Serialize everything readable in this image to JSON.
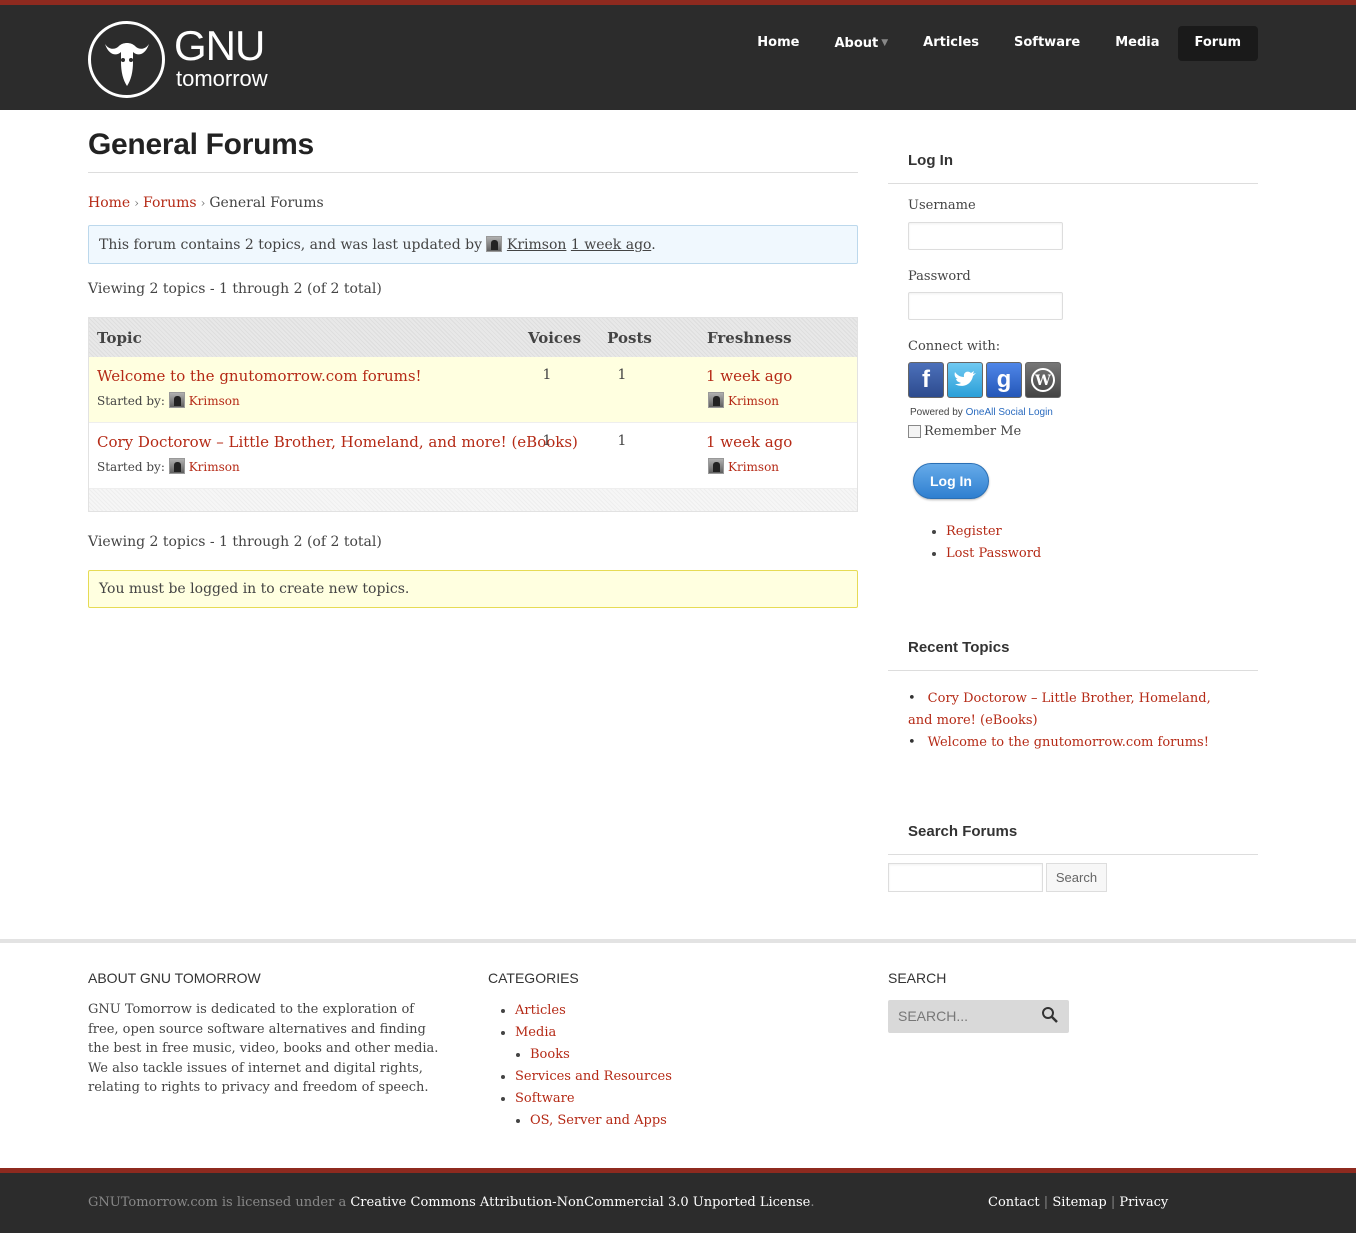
{
  "site": {
    "logo_title": "GNU",
    "logo_subtitle": "tomorrow"
  },
  "nav": {
    "items": [
      {
        "label": "Home"
      },
      {
        "label": "About"
      },
      {
        "label": "Articles"
      },
      {
        "label": "Software"
      },
      {
        "label": "Media"
      },
      {
        "label": "Forum"
      }
    ],
    "active": "Forum"
  },
  "main": {
    "title": "General Forums",
    "breadcrumb": [
      "Home",
      "Forums",
      "General Forums"
    ],
    "info": {
      "prefix": "This forum contains 2 topics, and was last updated by",
      "user": "Krimson",
      "time": "1 week ago",
      "suffix": "."
    },
    "viewing": "Viewing 2 topics - 1 through 2 (of 2 total)",
    "table": {
      "headers": [
        "Topic",
        "Voices",
        "Posts",
        "Freshness"
      ],
      "started_by_label": "Started by:",
      "rows": [
        {
          "title": "Welcome to the gnutomorrow.com forums!",
          "author": "Krimson",
          "voices": "1",
          "posts": "1",
          "freshness": "1 week ago",
          "last_by": "Krimson"
        },
        {
          "title": "Cory Doctorow – Little Brother, Homeland, and more! (eBooks)",
          "author": "Krimson",
          "voices": "1",
          "posts": "1",
          "freshness": "1 week ago",
          "last_by": "Krimson"
        }
      ]
    },
    "notice": "You must be logged in to create new topics."
  },
  "sidebar": {
    "login": {
      "title": "Log In",
      "username_label": "Username",
      "password_label": "Password",
      "connect_label": "Connect with:",
      "powered_prefix": "Powered by",
      "powered_link": "OneAll Social Login",
      "remember": "Remember Me",
      "button": "Log In",
      "links": [
        "Register",
        "Lost Password"
      ]
    },
    "recent": {
      "title": "Recent Topics",
      "items": [
        "Cory Doctorow – Little Brother, Homeland, and more! (eBooks)",
        "Welcome to the gnutomorrow.com forums!"
      ]
    },
    "search": {
      "title": "Search Forums",
      "button": "Search"
    }
  },
  "footer": {
    "about_title": "ABOUT GNU TOMORROW",
    "about_text": "GNU Tomorrow is dedicated to the exploration of free, open source software alternatives and finding the best in free music, video, books and other media. We also tackle issues of internet and digital rights, relating to rights to privacy and freedom of speech.",
    "categories_title": "CATEGORIES",
    "categories": {
      "articles": "Articles",
      "media": "Media",
      "books": "Books",
      "services": "Services and Resources",
      "software": "Software",
      "os": "OS, Server and Apps"
    },
    "search_title": "SEARCH",
    "search_placeholder": "SEARCH...",
    "license_prefix": "GNUTomorrow.com is licensed under a",
    "license_link": "Creative Commons Attribution-NonCommercial 3.0 Unported License",
    "license_suffix": ".",
    "links": [
      "Contact",
      "Sitemap",
      "Privacy"
    ],
    "link_sep": "|"
  },
  "colors": {
    "accent_red": "#b52a16",
    "header_bg": "#2c2c2c",
    "button_blue": "#2f7fd0"
  }
}
